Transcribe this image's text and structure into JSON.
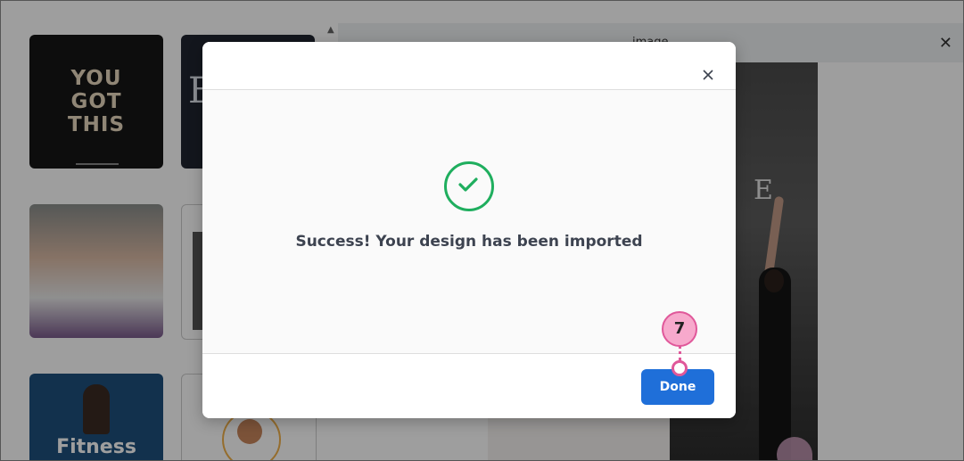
{
  "background": {
    "templates": [
      {
        "name": "you-got-this",
        "text": "YOU\nGOT\nTHIS"
      },
      {
        "name": "yoga-poster",
        "text": "E"
      },
      {
        "name": "group-photo",
        "text": ""
      },
      {
        "name": "document-template",
        "text": ""
      },
      {
        "name": "fitness-poster",
        "text": "Fitness"
      },
      {
        "name": "trainer-profile",
        "text": ""
      }
    ]
  },
  "preview": {
    "title": "image",
    "photo_letter": "E"
  },
  "modal": {
    "message": "Success! Your design has been imported",
    "done_label": "Done"
  },
  "annotation": {
    "step_number": "7"
  },
  "colors": {
    "success_green": "#1fae5e",
    "primary_blue": "#1f6fd9",
    "annotation_pink": "#e0589a"
  }
}
